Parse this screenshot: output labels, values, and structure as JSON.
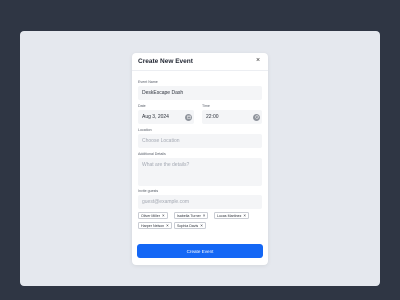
{
  "modal": {
    "title": "Create New Event",
    "close_symbol": "×",
    "close_icon": "close-icon",
    "submit_label": "Create Event"
  },
  "fields": {
    "event_name": {
      "label": "Event Name",
      "value": "DeskEscape Dash"
    },
    "date": {
      "label": "Date",
      "value": "Aug 3, 2024",
      "icon": "calendar-icon"
    },
    "time": {
      "label": "Time",
      "value": "22:00",
      "icon": "clock-icon"
    },
    "location": {
      "label": "Location",
      "placeholder": "Choose Location"
    },
    "details": {
      "label": "Additional Details",
      "placeholder": "What are the details?"
    },
    "guests": {
      "label": "Invite guests",
      "placeholder": "guest@example.com"
    }
  },
  "guests": [
    {
      "name": "Oliver Miller",
      "remove": "×"
    },
    {
      "name": "Isabella Turner",
      "remove": "×"
    },
    {
      "name": "Lucas Martinez",
      "remove": "×"
    },
    {
      "name": "Harper Nelson",
      "remove": "×"
    },
    {
      "name": "Sophia Davis",
      "remove": "×"
    }
  ],
  "colors": {
    "page_background": "#2f3644",
    "canvas": "#e5e8ee",
    "primary_button": "#1467f5",
    "field_background": "#f4f5f7"
  }
}
